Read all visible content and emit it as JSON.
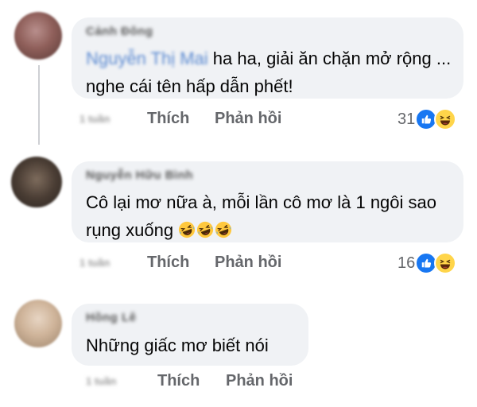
{
  "comments": [
    {
      "author": "Cảnh Đông",
      "mention": "Nguyễn Thị Mai",
      "text": "ha ha, giải ăn chặn mở rộng ... nghe cái tên hấp dẫn phết!",
      "timestamp": "1 tuần",
      "reaction_count": "31",
      "reactions": [
        "like-icon",
        "haha-icon"
      ]
    },
    {
      "author": "Nguyễn Hữu Bình",
      "text": "Cô lại mơ nữa à, mỗi lần cô mơ là 1 ngôi sao rụng xuống",
      "emojis": [
        "rolling-laughing-emoji",
        "rolling-laughing-emoji",
        "rolling-laughing-emoji"
      ],
      "timestamp": "1 tuần",
      "reaction_count": "16",
      "reactions": [
        "like-icon",
        "haha-icon"
      ]
    },
    {
      "author": "Hồng Lê",
      "text": "Những giấc mơ biết nói",
      "timestamp": "1 tuần"
    }
  ],
  "actions": {
    "like_label": "Thích",
    "reply_label": "Phản hồi"
  },
  "colors": {
    "bubble": "#f0f2f5",
    "secondary_text": "#65676b",
    "like_blue": "#1877f2",
    "haha_yellow": "#ffd54a"
  }
}
